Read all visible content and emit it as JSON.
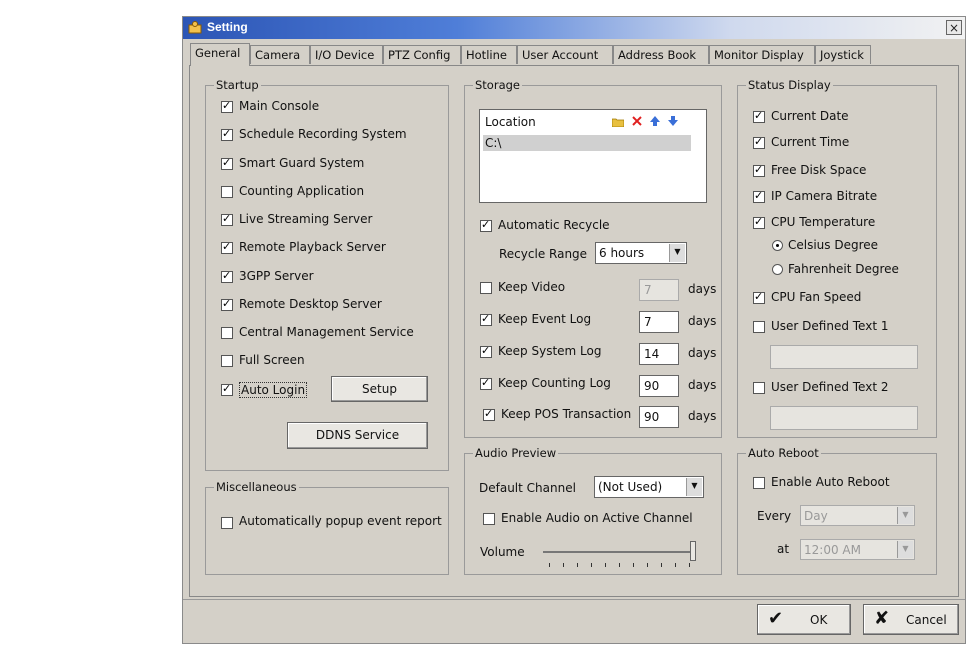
{
  "window": {
    "title": "Setting",
    "close_symbol": "×"
  },
  "tabs": [
    "General",
    "Camera",
    "I/O Device",
    "PTZ Config",
    "Hotline",
    "User Account",
    "Address Book",
    "Monitor Display",
    "Joystick"
  ],
  "startup": {
    "title": "Startup",
    "items": [
      {
        "label": "Main Console",
        "checked": true
      },
      {
        "label": "Schedule Recording System",
        "checked": true
      },
      {
        "label": "Smart Guard System",
        "checked": true
      },
      {
        "label": "Counting Application",
        "checked": false
      },
      {
        "label": "Live Streaming Server",
        "checked": true
      },
      {
        "label": "Remote Playback Server",
        "checked": true
      },
      {
        "label": "3GPP Server",
        "checked": true
      },
      {
        "label": "Remote Desktop Server",
        "checked": true
      },
      {
        "label": "Central Management Service",
        "checked": false
      },
      {
        "label": "Full Screen",
        "checked": false
      },
      {
        "label": "Auto Login",
        "checked": true
      }
    ],
    "setup_label": "Setup",
    "ddns_label": "DDNS Service"
  },
  "misc": {
    "title": "Miscellaneous",
    "popup_label": "Automatically popup event report",
    "popup_checked": false
  },
  "storage": {
    "title": "Storage",
    "location_header": "Location",
    "location_value": "C:\\",
    "auto_recycle_label": "Automatic Recycle",
    "auto_recycle_checked": true,
    "recycle_range_label": "Recycle Range",
    "recycle_range_value": "6 hours",
    "days_label": "days",
    "keeps": [
      {
        "label": "Keep Video",
        "checked": false,
        "value": "7",
        "disabled": true
      },
      {
        "label": "Keep Event Log",
        "checked": true,
        "value": "7",
        "disabled": false
      },
      {
        "label": "Keep System Log",
        "checked": true,
        "value": "14",
        "disabled": false
      },
      {
        "label": "Keep Counting Log",
        "checked": true,
        "value": "90",
        "disabled": false
      },
      {
        "label": "Keep POS Transaction",
        "checked": true,
        "value": "90",
        "disabled": false
      }
    ]
  },
  "audio": {
    "title": "Audio Preview",
    "default_channel_label": "Default Channel",
    "default_channel_value": "(Not Used)",
    "enable_label": "Enable Audio on Active Channel",
    "enable_checked": false,
    "volume_label": "Volume",
    "volume_level": 1.0
  },
  "status": {
    "title": "Status Display",
    "items": [
      {
        "label": "Current Date",
        "checked": true
      },
      {
        "label": "Current Time",
        "checked": true
      },
      {
        "label": "Free Disk Space",
        "checked": true
      },
      {
        "label": "IP Camera Bitrate",
        "checked": true
      },
      {
        "label": "CPU Temperature",
        "checked": true
      }
    ],
    "celsius_label": "Celsius Degree",
    "fahrenheit_label": "Fahrenheit Degree",
    "celsius_selected": true,
    "fan_label": "CPU Fan Speed",
    "fan_checked": true,
    "udt1_label": "User Defined Text 1",
    "udt1_checked": false,
    "udt2_label": "User Defined Text 2",
    "udt2_checked": false
  },
  "reboot": {
    "title": "Auto Reboot",
    "enable_label": "Enable Auto Reboot",
    "enable_checked": false,
    "every_label": "Every",
    "every_value": "Day",
    "at_label": "at",
    "at_value": "12:00 AM"
  },
  "footer": {
    "ok_label": "OK",
    "cancel_label": "Cancel"
  },
  "colors": {
    "titlebar_start": "#2c55b5",
    "dialog_bg": "#d4d0c8",
    "delete_icon": "#e02020",
    "folder_icon": "#e8c040",
    "arrow_icon": "#3a6fd8"
  }
}
